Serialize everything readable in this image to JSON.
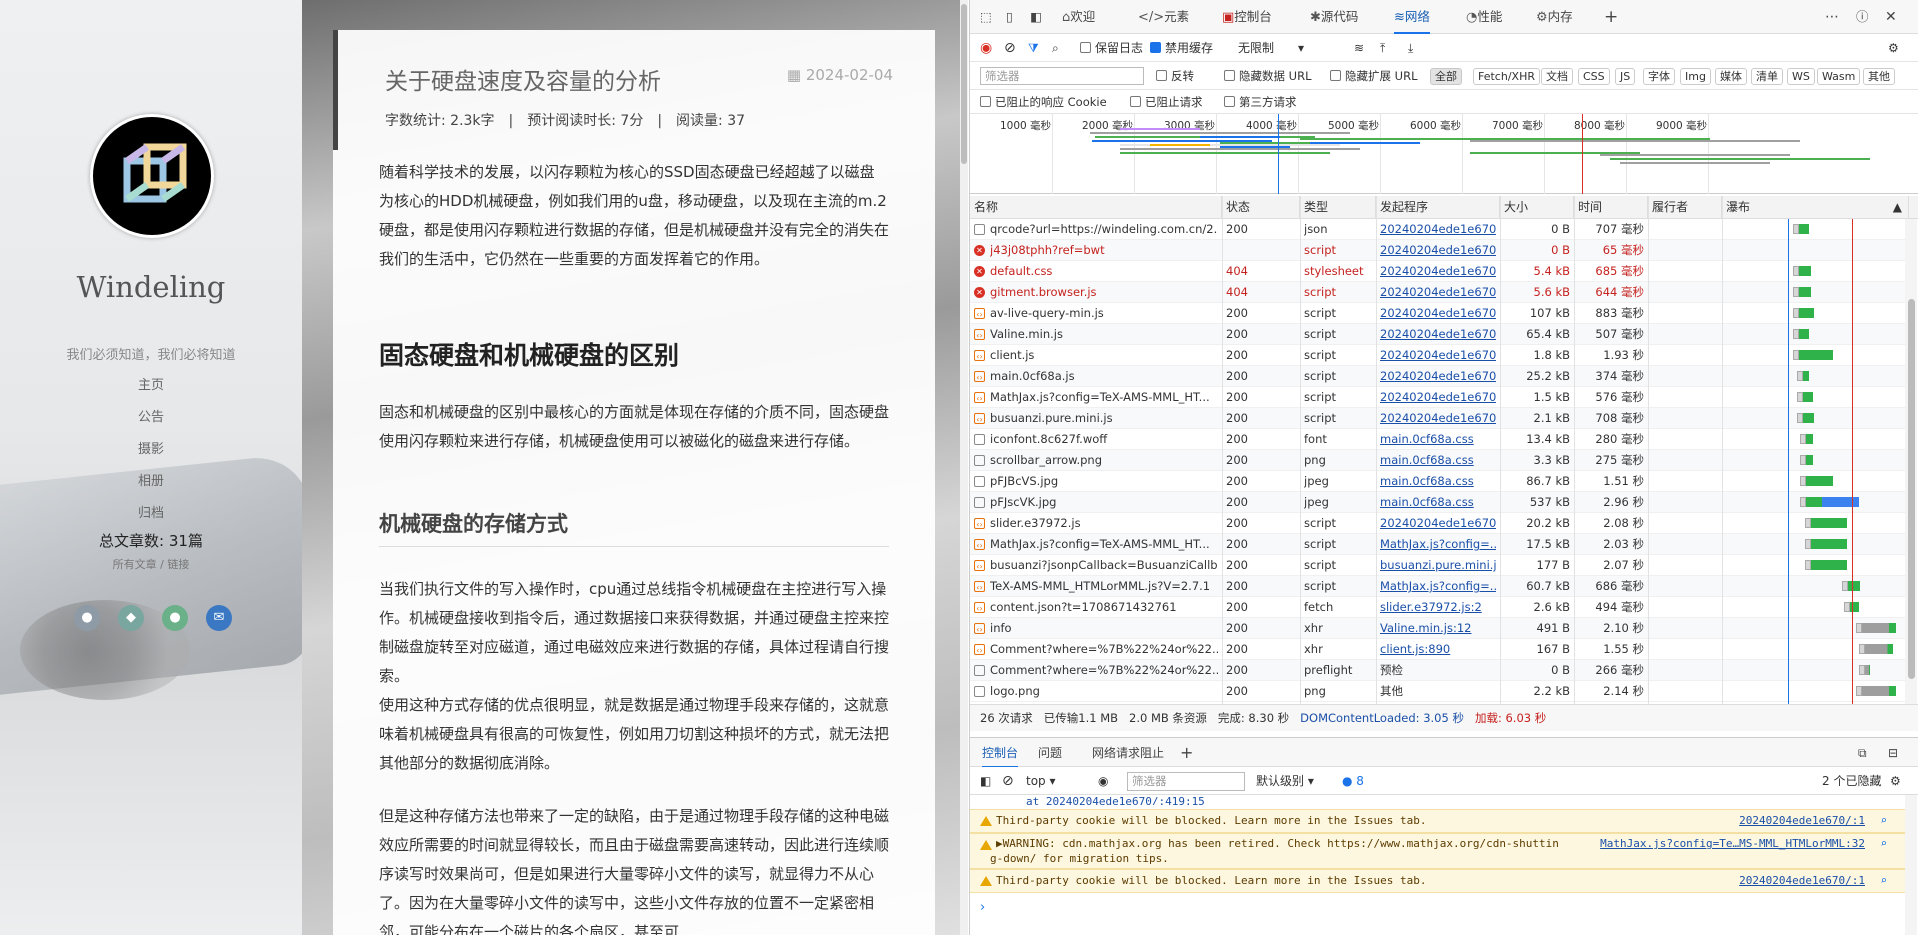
{
  "blog": {
    "site_name": "Windeling",
    "motto": "我们必须知道，我们必将知道",
    "nav": [
      "主页",
      "公告",
      "摄影",
      "相册",
      "归档"
    ],
    "post_count": "总文章数: 31篇",
    "post_links": "所有文章 / 链接",
    "social_icons": [
      "github-icon",
      "qq-icon",
      "wechat-icon",
      "email-icon"
    ],
    "article": {
      "title": "关于硬盘速度及容量的分析",
      "date": "2024-02-04",
      "meta": "字数统计: 2.3k字　|　预计阅读时长: 7分　|　阅读量: 37",
      "p1": "随着科学技术的发展，以闪存颗粒为核心的SSD固态硬盘已经超越了以磁盘为核心的HDD机械硬盘，例如我们用的u盘，移动硬盘，以及现在主流的m.2硬盘，都是使用闪存颗粒进行数据的存储，但是机械硬盘并没有完全的消失在我们的生活中，它仍然在一些重要的方面发挥着它的作用。",
      "h2": "固态硬盘和机械硬盘的区别",
      "p2": "固态和机械硬盘的区别中最核心的方面就是体现在存储的介质不同，固态硬盘使用闪存颗粒来进行存储，机械硬盘使用可以被磁化的磁盘来进行存储。",
      "h3": "机械硬盘的存储方式",
      "p3": "当我们执行文件的写入操作时，cpu通过总线指令机械硬盘在主控进行写入操作。机械硬盘接收到指令后，通过数据接口来获得数据，并通过硬盘主控来控制磁盘旋转至对应磁道，通过电磁效应来进行数据的存储，具体过程请自行搜索。",
      "p4": "使用这种方式存储的优点很明显，就是数据是通过物理手段来存储的，这就意味着机械硬盘具有很高的可恢复性，例如用刀切割这种损坏的方式，就无法把其他部分的数据彻底消除。",
      "p5": "但是这种存储方法也带来了一定的缺陷，由于是通过物理手段存储的这种电磁效应所需要的时间就显得较长，而且由于磁盘需要高速转动，因此进行连续顺序读写时效果尚可，但是如果进行大量零碎小文件的读写，就显得力不从心了。因为在大量零碎小文件的读写中，这些小文件存放的位置不一定紧密相邻，可能分布在一个磁片的各个扇区，甚至可"
    }
  },
  "devtools": {
    "tabs": [
      "欢迎",
      "元素",
      "控制台",
      "源代码",
      "网络",
      "性能",
      "内存"
    ],
    "active_tab": "网络",
    "toolbar": {
      "preserve_log": "保留日志",
      "disable_cache": "禁用缓存",
      "throttle": "无限制"
    },
    "filter": {
      "placeholder": "筛选器",
      "invert": "反转",
      "hide_data_urls": "隐藏数据 URL",
      "hide_ext_urls": "隐藏扩展 URL",
      "types": [
        "全部",
        "Fetch/XHR",
        "文档",
        "CSS",
        "JS",
        "字体",
        "Img",
        "媒体",
        "清单",
        "WS",
        "Wasm",
        "其他"
      ],
      "blocked_cookies": "已阻止的响应 Cookie",
      "blocked_requests": "已阻止请求",
      "third_party": "第三方请求"
    },
    "overview_ticks": [
      "1000 毫秒",
      "2000 毫秒",
      "3000 毫秒",
      "4000 毫秒",
      "5000 毫秒",
      "6000 毫秒",
      "7000 毫秒",
      "8000 毫秒",
      "9000 毫秒"
    ],
    "columns": [
      "名称",
      "状态",
      "类型",
      "发起程序",
      "大小",
      "时间",
      "履行者",
      "瀑布"
    ],
    "rows": [
      {
        "name": "qrcode?url=https://windeling.com.cn/2...",
        "status": "200",
        "type": "json",
        "initiator": "20240204ede1e670...",
        "size": "0 B",
        "time": "707 毫秒",
        "icon": "doc",
        "err": false,
        "wf": [
          0.43,
          0.06
        ]
      },
      {
        "name": "j43j08tphh?ref=bwt",
        "status": "",
        "type": "script",
        "initiator": "20240204ede1e670...",
        "size": "0 B",
        "time": "65 毫秒",
        "icon": "err",
        "err": true,
        "wf": [
          0.0,
          0.0
        ]
      },
      {
        "name": "default.css",
        "status": "404",
        "type": "stylesheet",
        "initiator": "20240204ede1e670...",
        "size": "5.4 kB",
        "time": "685 毫秒",
        "icon": "err",
        "err": true,
        "wf": [
          0.43,
          0.07
        ]
      },
      {
        "name": "gitment.browser.js",
        "status": "404",
        "type": "script",
        "initiator": "20240204ede1e670...",
        "size": "5.6 kB",
        "time": "644 毫秒",
        "icon": "err",
        "err": true,
        "wf": [
          0.43,
          0.07
        ]
      },
      {
        "name": "av-live-query-min.js",
        "status": "200",
        "type": "script",
        "initiator": "20240204ede1e670...",
        "size": "107 kB",
        "time": "883 毫秒",
        "icon": "script",
        "err": false,
        "wf": [
          0.43,
          0.09
        ]
      },
      {
        "name": "Valine.min.js",
        "status": "200",
        "type": "script",
        "initiator": "20240204ede1e670...",
        "size": "65.4 kB",
        "time": "507 毫秒",
        "icon": "script",
        "err": false,
        "wf": [
          0.43,
          0.06
        ]
      },
      {
        "name": "client.js",
        "status": "200",
        "type": "script",
        "initiator": "20240204ede1e670...",
        "size": "1.8 kB",
        "time": "1.93 秒",
        "icon": "script",
        "err": false,
        "wf": [
          0.43,
          0.2
        ]
      },
      {
        "name": "main.0cf68a.js",
        "status": "200",
        "type": "script",
        "initiator": "20240204ede1e670...",
        "size": "25.2 kB",
        "time": "374 毫秒",
        "icon": "script",
        "err": false,
        "wf": [
          0.45,
          0.04
        ]
      },
      {
        "name": "MathJax.js?config=TeX-AMS-MML_HT...",
        "status": "200",
        "type": "script",
        "initiator": "20240204ede1e670...",
        "size": "1.5 kB",
        "time": "576 毫秒",
        "icon": "script",
        "err": false,
        "wf": [
          0.45,
          0.06
        ]
      },
      {
        "name": "busuanzi.pure.mini.js",
        "status": "200",
        "type": "script",
        "initiator": "20240204ede1e670...",
        "size": "2.1 kB",
        "time": "708 毫秒",
        "icon": "script",
        "err": false,
        "wf": [
          0.45,
          0.07
        ]
      },
      {
        "name": "iconfont.8c627f.woff",
        "status": "200",
        "type": "font",
        "initiator": "main.0cf68a.css",
        "size": "13.4 kB",
        "time": "280 毫秒",
        "icon": "doc",
        "err": false,
        "wf": [
          0.47,
          0.04
        ]
      },
      {
        "name": "scrollbar_arrow.png",
        "status": "200",
        "type": "png",
        "initiator": "main.0cf68a.css",
        "size": "3.3 kB",
        "time": "275 毫秒",
        "icon": "doc",
        "err": false,
        "wf": [
          0.47,
          0.04
        ]
      },
      {
        "name": "pFJBcVS.jpg",
        "status": "200",
        "type": "jpeg",
        "initiator": "main.0cf68a.css",
        "size": "86.7 kB",
        "time": "1.51 秒",
        "icon": "doc",
        "err": false,
        "wf": [
          0.47,
          0.16
        ]
      },
      {
        "name": "pFJscVK.jpg",
        "status": "200",
        "type": "jpeg",
        "initiator": "main.0cf68a.css",
        "size": "537 kB",
        "time": "2.96 秒",
        "icon": "doc",
        "err": false,
        "wf": [
          0.47,
          0.31
        ]
      },
      {
        "name": "slider.e37972.js",
        "status": "200",
        "type": "script",
        "initiator": "20240204ede1e670...",
        "size": "20.2 kB",
        "time": "2.08 秒",
        "icon": "script",
        "err": false,
        "wf": [
          0.5,
          0.21
        ]
      },
      {
        "name": "MathJax.js?config=TeX-AMS-MML_HT...",
        "status": "200",
        "type": "script",
        "initiator": "MathJax.js?config=...",
        "size": "17.5 kB",
        "time": "2.03 秒",
        "icon": "script",
        "err": false,
        "wf": [
          0.5,
          0.21
        ]
      },
      {
        "name": "busuanzi?jsonpCallback=BusuanziCallb...",
        "status": "200",
        "type": "script",
        "initiator": "busuanzi.pure.mini.j...",
        "size": "177 B",
        "time": "2.07 秒",
        "icon": "script",
        "err": false,
        "wf": [
          0.5,
          0.21
        ]
      },
      {
        "name": "TeX-AMS-MML_HTMLorMML.js?V=2.7.1",
        "status": "200",
        "type": "script",
        "initiator": "MathJax.js?config=...",
        "size": "60.7 kB",
        "time": "686 毫秒",
        "icon": "script",
        "err": false,
        "wf": [
          0.72,
          0.07
        ]
      },
      {
        "name": "content.json?t=1708671432761",
        "status": "200",
        "type": "fetch",
        "initiator": "slider.e37972.js:2",
        "size": "2.6 kB",
        "time": "494 毫秒",
        "icon": "script",
        "err": false,
        "wf": [
          0.73,
          0.05
        ]
      },
      {
        "name": "info",
        "status": "200",
        "type": "xhr",
        "initiator": "Valine.min.js:12",
        "size": "491 B",
        "time": "2.10 秒",
        "icon": "script",
        "err": false,
        "wf": [
          0.8,
          0.2
        ]
      },
      {
        "name": "Comment?where=%7B%22%24or%22...",
        "status": "200",
        "type": "xhr",
        "initiator": "client.js:890",
        "size": "167 B",
        "time": "1.55 秒",
        "icon": "script",
        "err": false,
        "wf": [
          0.82,
          0.16
        ]
      },
      {
        "name": "Comment?where=%7B%22%24or%22...",
        "status": "200",
        "type": "preflight",
        "initiator": "预检",
        "size": "0 B",
        "time": "266 毫秒",
        "icon": "doc",
        "err": false,
        "wf": [
          0.82,
          0.03
        ]
      },
      {
        "name": "logo.png",
        "status": "200",
        "type": "png",
        "initiator": "其他",
        "size": "2.2 kB",
        "time": "2.14 秒",
        "icon": "doc",
        "err": false,
        "wf": [
          0.8,
          0.2
        ]
      }
    ],
    "status_bar": {
      "requests": "26 次请求",
      "transferred": "已传输1.1 MB",
      "resources": "2.0 MB 条资源",
      "finish": "完成: 8.30 秒",
      "dcl": "DOMContentLoaded: 3.05 秒",
      "load": "加载: 6.03 秒"
    },
    "drawer_tabs": [
      "控制台",
      "问题",
      "网络请求阻止"
    ],
    "console": {
      "context": "top",
      "filter_placeholder": "筛选器",
      "level": "默认级别",
      "issue_count": "8",
      "hidden": "2 个已隐藏",
      "partial_line": "at 20240204ede1e670/:419:15",
      "messages": [
        {
          "text": "Third-party cookie will be blocked. Learn more in the Issues tab.",
          "source": "20240204ede1e670/:1"
        },
        {
          "text": "▶WARNING: cdn.mathjax.org has been retired. Check https://www.mathjax.org/cdn-shuttin",
          "text2": "g-down/ for migration tips.",
          "source": "MathJax.js?config=Te…MS-MML_HTMLorMML:32"
        },
        {
          "text": "Third-party cookie will be blocked. Learn more in the Issues tab.",
          "source": "20240204ede1e670/:1"
        }
      ]
    }
  }
}
